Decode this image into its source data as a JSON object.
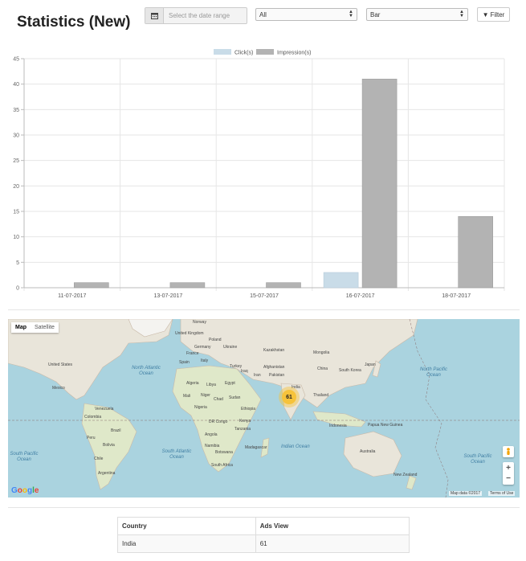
{
  "page": {
    "title": "Statistics (New)"
  },
  "filters": {
    "date_placeholder": "Select the date range",
    "select_scope": "All",
    "select_chart": "Bar",
    "filter_label": "Filter"
  },
  "chart_data": {
    "type": "bar",
    "categories": [
      "11-07-2017",
      "13-07-2017",
      "15-07-2017",
      "16-07-2017",
      "18-07-2017"
    ],
    "series": [
      {
        "name": "Click(s)",
        "values": [
          0,
          0,
          0,
          3,
          0
        ],
        "color": "#c9dce8"
      },
      {
        "name": "Impression(s)",
        "values": [
          1,
          1,
          1,
          41,
          14
        ],
        "color": "#b3b3b3"
      }
    ],
    "yticks": [
      0,
      5,
      10,
      15,
      20,
      25,
      30,
      35,
      40,
      45
    ],
    "ylim": [
      0,
      45
    ],
    "grid": true,
    "legend": "top"
  },
  "map": {
    "type_map": "Map",
    "type_satellite": "Satellite",
    "cluster_count": "61",
    "zoom_in": "+",
    "zoom_out": "−",
    "logo": "Google",
    "map_data": "Map data ©2017",
    "terms": "Terms of Use",
    "labels": {
      "north_atlantic": "North Atlantic Ocean",
      "south_atlantic": "South Atlantic Ocean",
      "indian": "Indian Ocean",
      "north_pacific": "North Pacific Ocean",
      "south_pacific": "South Pacific Ocean",
      "south_pacific_left": "South Pacific Ocean",
      "united_states": "United States",
      "mexico": "Mexico",
      "venezuela": "Venezuela",
      "colombia": "Colombia",
      "peru": "Peru",
      "brazil": "Brazil",
      "bolivia": "Bolivia",
      "chile": "Chile",
      "argentina": "Argentina",
      "norway": "Norway",
      "uk": "United Kingdom",
      "poland": "Poland",
      "germany": "Germany",
      "ukraine": "Ukraine",
      "france": "France",
      "italy": "Italy",
      "spain": "Spain",
      "turkey": "Turkey",
      "kazakhstan": "Kazakhstan",
      "mongolia": "Mongolia",
      "china": "China",
      "japan": "Japan",
      "south_korea": "South Korea",
      "afghanistan": "Afghanistan",
      "pakistan": "Pakistan",
      "iran": "Iran",
      "iraq": "Iraq",
      "india": "India",
      "thailand": "Thailand",
      "algeria": "Algeria",
      "libya": "Libya",
      "egypt": "Egypt",
      "mali": "Mali",
      "niger": "Niger",
      "chad": "Chad",
      "sudan": "Sudan",
      "nigeria": "Nigeria",
      "ethiopia": "Ethiopia",
      "kenya": "Kenya",
      "drc": "DR Congo",
      "tanzania": "Tanzania",
      "angola": "Angola",
      "namibia": "Namibia",
      "botswana": "Botswana",
      "south_africa": "South Africa",
      "madagascar": "Madagascar",
      "indonesia": "Indonesia",
      "png": "Papua New Guinea",
      "australia": "Australia",
      "new_zealand": "New Zealand"
    }
  },
  "table": {
    "headers": [
      "Country",
      "Ads View"
    ],
    "rows": [
      [
        "India",
        "61"
      ]
    ]
  }
}
